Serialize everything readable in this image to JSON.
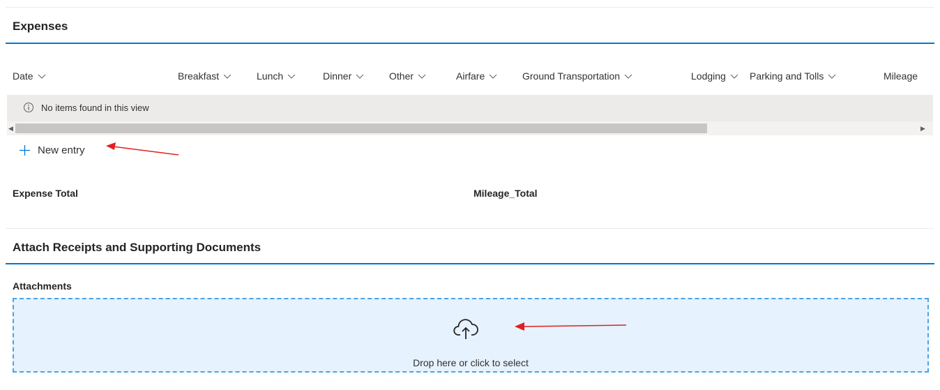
{
  "expenses": {
    "title": "Expenses",
    "columns": [
      {
        "label": "Date"
      },
      {
        "label": "Breakfast"
      },
      {
        "label": "Lunch"
      },
      {
        "label": "Dinner"
      },
      {
        "label": "Other"
      },
      {
        "label": "Airfare"
      },
      {
        "label": "Ground Transportation"
      },
      {
        "label": "Lodging"
      },
      {
        "label": "Parking and Tolls"
      },
      {
        "label": "Mileage"
      }
    ],
    "empty_message": "No items found in this view",
    "new_entry_label": "New entry",
    "expense_total_label": "Expense Total",
    "mileage_total_label": "Mileage_Total"
  },
  "attachments_section": {
    "title": "Attach Receipts and Supporting Documents",
    "field_label": "Attachments",
    "drop_text": "Drop here or click to select"
  },
  "icons": {
    "chevron": "chevron-down-icon",
    "info": "info-icon",
    "add": "plus-icon",
    "upload": "cloud-upload-icon",
    "annotation": "red-arrow-icon"
  },
  "colors": {
    "accent": "#0078d4",
    "dropzone_bg": "#e6f2fd",
    "dropzone_border": "#4aa3e8",
    "annotation_arrow": "#e02020"
  }
}
